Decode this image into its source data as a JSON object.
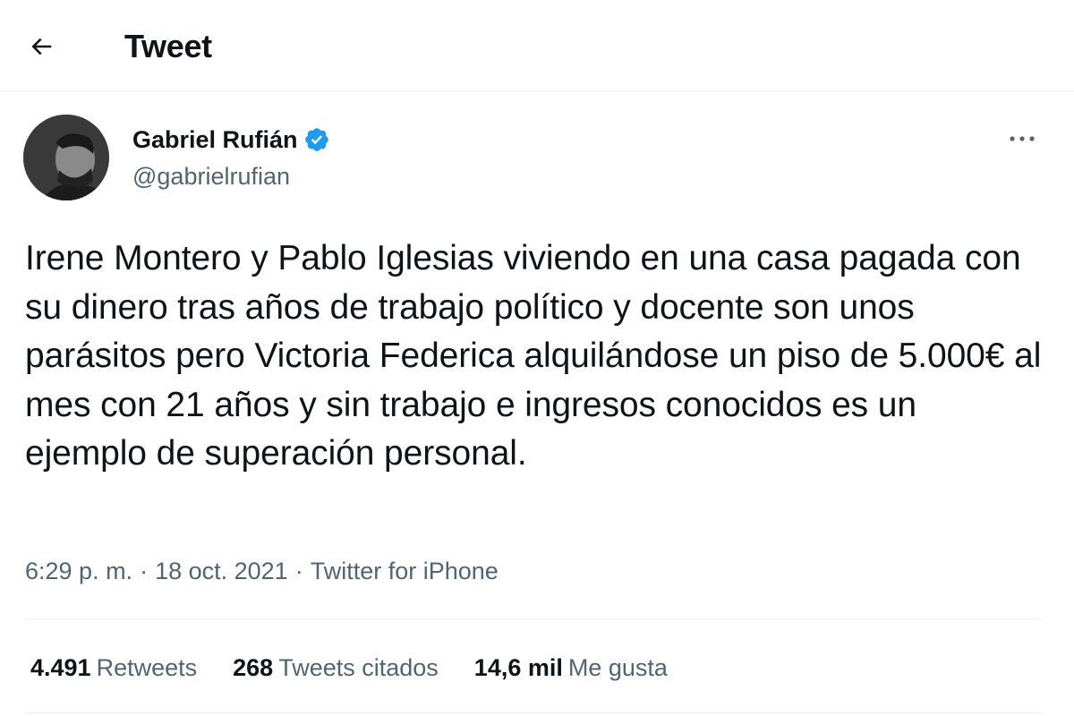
{
  "header": {
    "title": "Tweet",
    "back_icon": "arrow-left-icon"
  },
  "author": {
    "display_name": "Gabriel Rufián",
    "handle": "@gabrielrufian",
    "verified_icon": "verified-badge-icon",
    "verified_color": "#1d9bf0"
  },
  "tweet": {
    "text": "Irene Montero y Pablo Iglesias viviendo en una casa pagada con su dinero tras años de trabajo político y docente son unos parásitos pero Victoria Federica alquilándose un piso de 5.000€ al mes con 21 años y sin trabajo e ingresos conocidos es un ejemplo de superación personal.",
    "time": "6:29 p. m.",
    "date": "18 oct. 2021",
    "source": "Twitter for iPhone",
    "separator": "·"
  },
  "stats": {
    "retweets_count": "4.491",
    "retweets_label": "Retweets",
    "quotes_count": "268",
    "quotes_label": "Tweets citados",
    "likes_count": "14,6 mil",
    "likes_label": "Me gusta"
  },
  "colors": {
    "text_primary": "#0f1419",
    "text_secondary": "#536471",
    "divider": "#eff3f4",
    "accent": "#1d9bf0"
  }
}
